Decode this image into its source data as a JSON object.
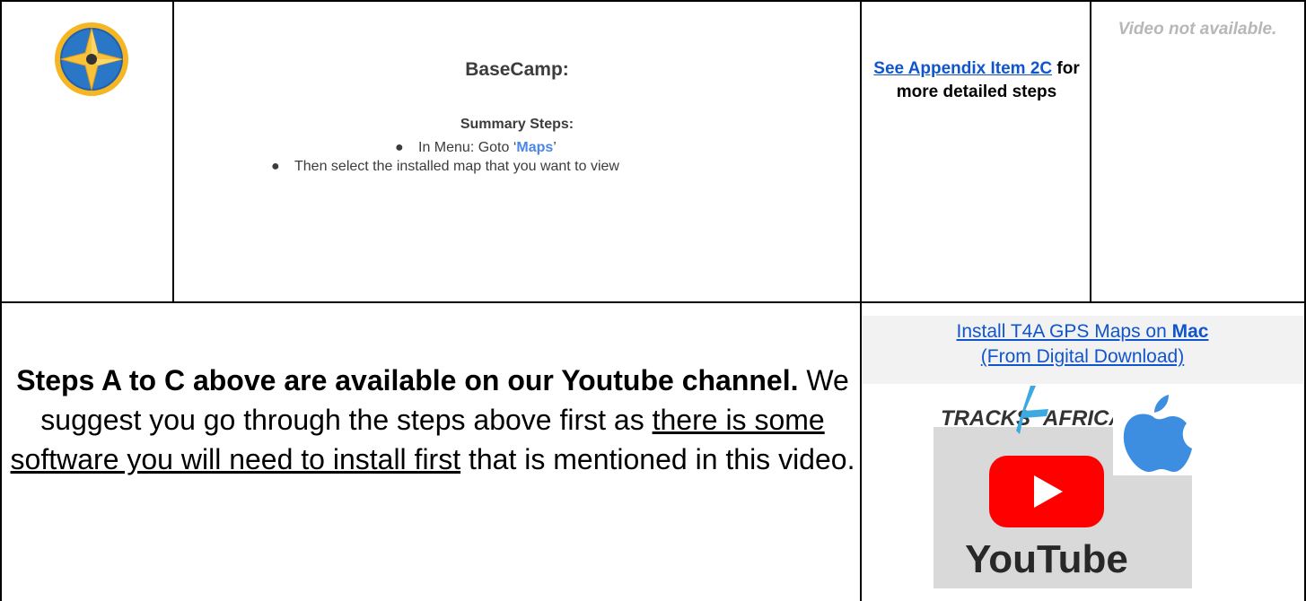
{
  "row1": {
    "icon": "basecamp-compass-icon",
    "title": "BaseCamp:",
    "summary_heading": "Summary Steps:",
    "steps": [
      {
        "prefix": "In Menu: Goto ‘",
        "highlight": "Maps",
        "suffix": "’"
      },
      {
        "text": "Then select the installed map that you want to view"
      }
    ],
    "appendix_link": "See Appendix Item 2C",
    "appendix_rest": " for more detailed steps",
    "video_status": "Video not available."
  },
  "row2": {
    "text_bold": "Steps A to C above are available on our Youtube channel.",
    "text_mid": " We suggest you go through the steps above first as ",
    "text_underline": "there is some software you will need to install first",
    "text_end": " that is mentioned in this video.",
    "video_link_prefix": "Install T4A GPS Maps on ",
    "video_link_bold": "Mac",
    "video_link_suffix": "(From Digital Download)",
    "thumbnail": {
      "brand_left": "TRACKS",
      "brand_right": "AFRICA",
      "youtube_word": "YouTube",
      "colors": {
        "youtube_red": "#ff0000",
        "apple_blue": "#3d8ee0",
        "tracks_green": "#3ca9e0"
      }
    }
  }
}
